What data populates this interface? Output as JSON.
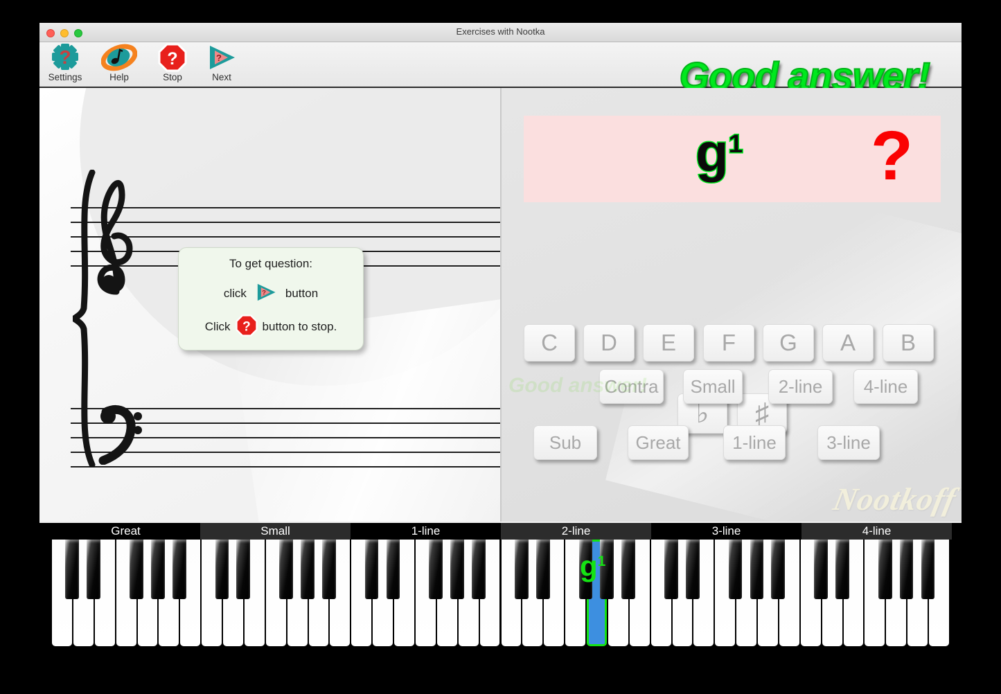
{
  "window": {
    "title": "Exercises with Nootka",
    "traffic_lights": [
      "close",
      "minimize",
      "maximize"
    ]
  },
  "toolbar": {
    "buttons": [
      {
        "label": "Settings",
        "icon": "gear-question-icon"
      },
      {
        "label": "Help",
        "icon": "note-oval-icon"
      },
      {
        "label": "Stop",
        "icon": "stop-octagon-question-icon"
      },
      {
        "label": "Next",
        "icon": "play-triangle-question-icon"
      }
    ],
    "status_message": "Good answer!",
    "status_color": "#00e81e"
  },
  "score": {
    "clefs": [
      "treble-clef",
      "bass-clef"
    ],
    "brace": "grand-staff-brace",
    "tip": {
      "line1": "To get question:",
      "line2_prefix": "click",
      "line2_suffix": "button",
      "line3_prefix": "Click",
      "line3_suffix": "button to stop.",
      "icon_next": "play-triangle-question-icon",
      "icon_stop": "stop-octagon-question-icon"
    }
  },
  "panel": {
    "question": {
      "note": "g",
      "octave_superscript": "1",
      "question_mark": "?",
      "background": "#fbdfdf",
      "note_outline_color": "#00e81e",
      "question_mark_color": "#fa0202"
    },
    "note_buttons": [
      "C",
      "D",
      "E",
      "F",
      "G",
      "A",
      "B"
    ],
    "accidental_buttons": [
      "♭",
      "♯"
    ],
    "octave_buttons_row1": [
      "Contra",
      "Small",
      "2-line",
      "4-line"
    ],
    "octave_buttons_row2": [
      "Sub",
      "Great",
      "1-line",
      "3-line"
    ],
    "fading_message": "Good answer!",
    "watermark": "Nootkoff"
  },
  "piano": {
    "octave_labels": [
      "Great",
      "Small",
      "1-line",
      "2-line",
      "3-line",
      "4-line"
    ],
    "highlighted_key": {
      "note": "g",
      "octave_superscript": "1",
      "fill_color": "#3d8fe0",
      "outline_color": "#15e314"
    }
  }
}
